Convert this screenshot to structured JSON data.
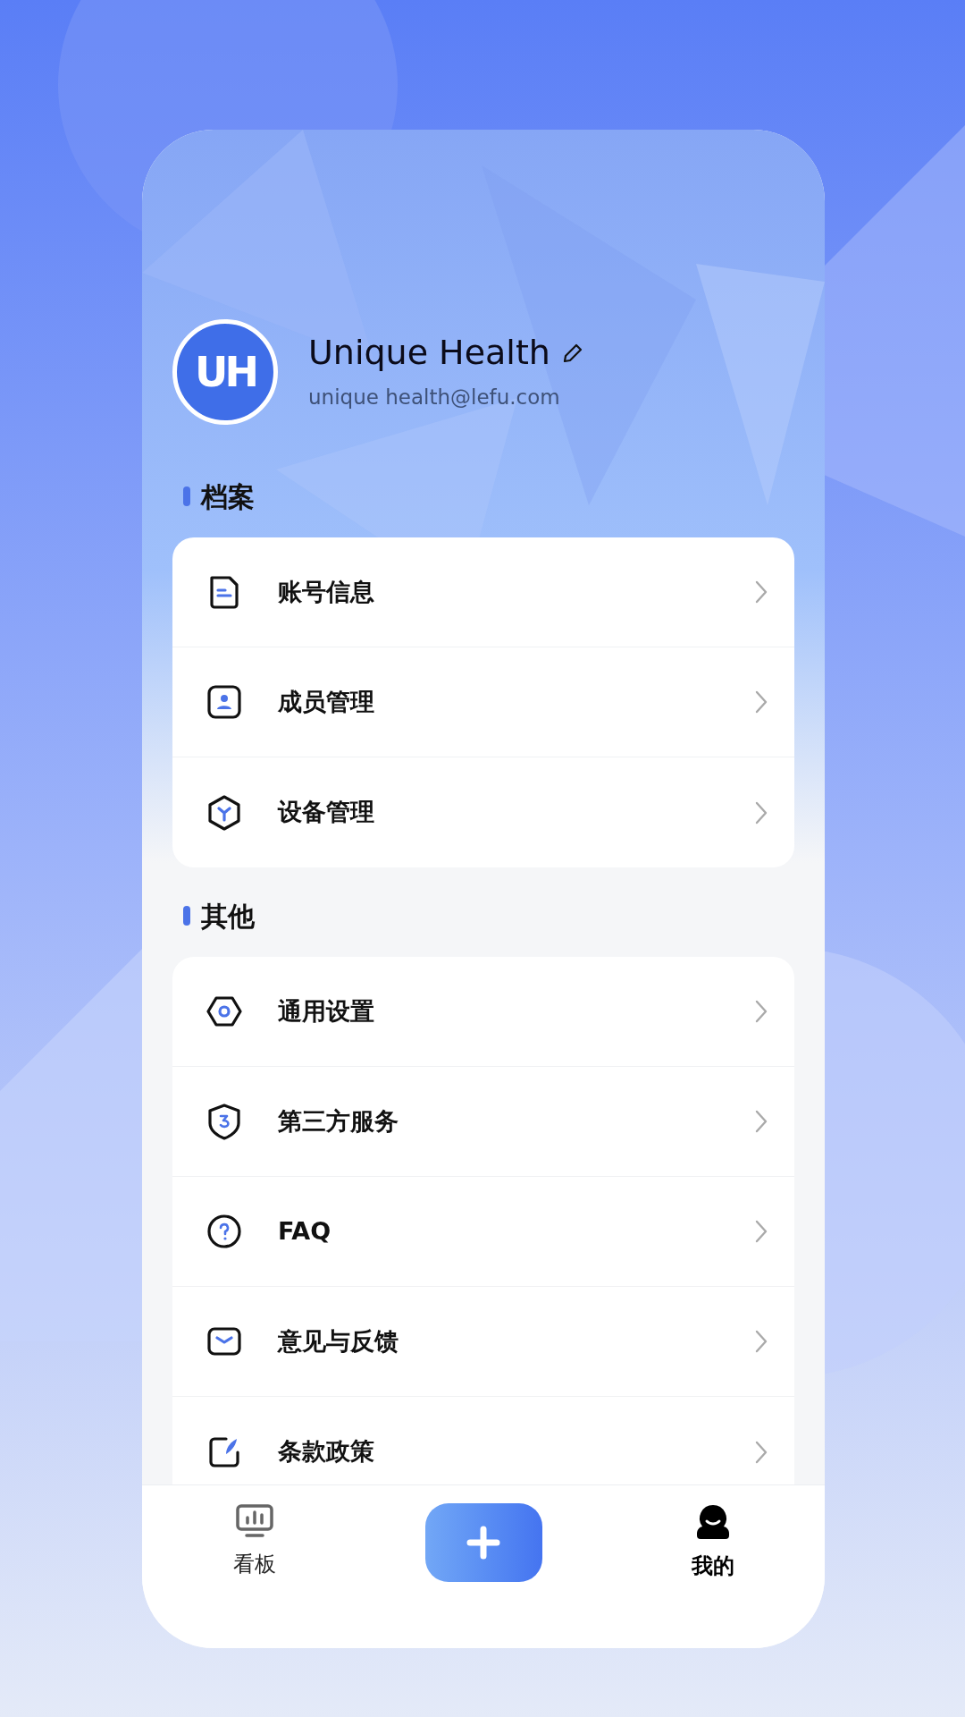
{
  "profile": {
    "name": "Unique Health",
    "email": "unique health@lefu.com",
    "avatar_text": "UH"
  },
  "sections": [
    {
      "title": "档案",
      "items": [
        {
          "label": "账号信息"
        },
        {
          "label": "成员管理"
        },
        {
          "label": "设备管理"
        }
      ]
    },
    {
      "title": "其他",
      "items": [
        {
          "label": "通用设置"
        },
        {
          "label": "第三方服务"
        },
        {
          "label": "FAQ"
        },
        {
          "label": "意见与反馈"
        },
        {
          "label": "条款政策"
        }
      ]
    }
  ],
  "tab_bar": [
    {
      "label": "看板",
      "kind": "tab",
      "selected": false
    },
    {
      "kind": "add"
    },
    {
      "label": "我的",
      "kind": "tab",
      "selected": true
    }
  ]
}
